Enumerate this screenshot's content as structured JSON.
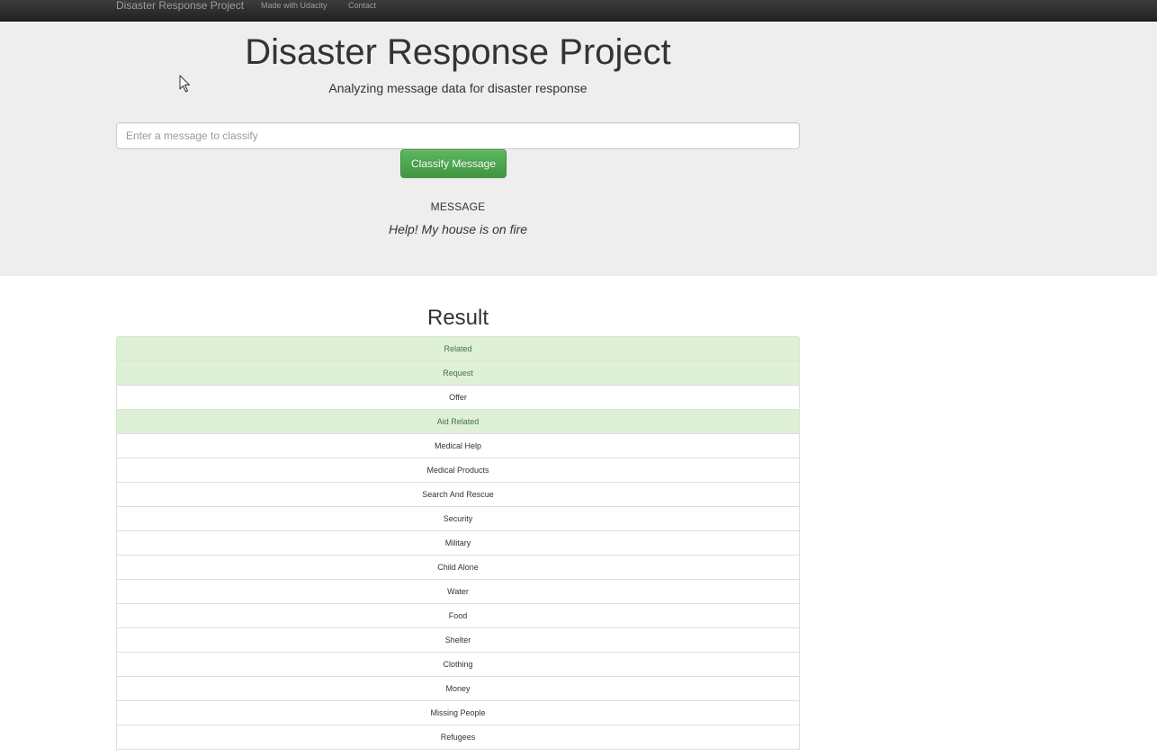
{
  "navbar": {
    "brand": "Disaster Response Project",
    "links": [
      {
        "label": "Made with Udacity"
      },
      {
        "label": "Contact"
      }
    ]
  },
  "header": {
    "title": "Disaster Response Project",
    "subtitle": "Analyzing message data for disaster response"
  },
  "form": {
    "placeholder": "Enter a message to classify",
    "value": "",
    "button_label": "Classify Message"
  },
  "message": {
    "heading": "MESSAGE",
    "text": "Help! My house is on fire"
  },
  "result": {
    "title": "Result",
    "items": [
      {
        "label": "Related",
        "positive": true
      },
      {
        "label": "Request",
        "positive": true
      },
      {
        "label": "Offer",
        "positive": false
      },
      {
        "label": "Aid Related",
        "positive": true
      },
      {
        "label": "Medical Help",
        "positive": false
      },
      {
        "label": "Medical Products",
        "positive": false
      },
      {
        "label": "Search And Rescue",
        "positive": false
      },
      {
        "label": "Security",
        "positive": false
      },
      {
        "label": "Military",
        "positive": false
      },
      {
        "label": "Child Alone",
        "positive": false
      },
      {
        "label": "Water",
        "positive": false
      },
      {
        "label": "Food",
        "positive": false
      },
      {
        "label": "Shelter",
        "positive": false
      },
      {
        "label": "Clothing",
        "positive": false
      },
      {
        "label": "Money",
        "positive": false
      },
      {
        "label": "Missing People",
        "positive": false
      },
      {
        "label": "Refugees",
        "positive": false
      }
    ]
  },
  "colors": {
    "navbar_bg": "#222222",
    "jumbotron_bg": "#eeeeee",
    "button_green": "#5cb85c",
    "positive_bg": "#dff0d8",
    "positive_text": "#3c763d"
  }
}
